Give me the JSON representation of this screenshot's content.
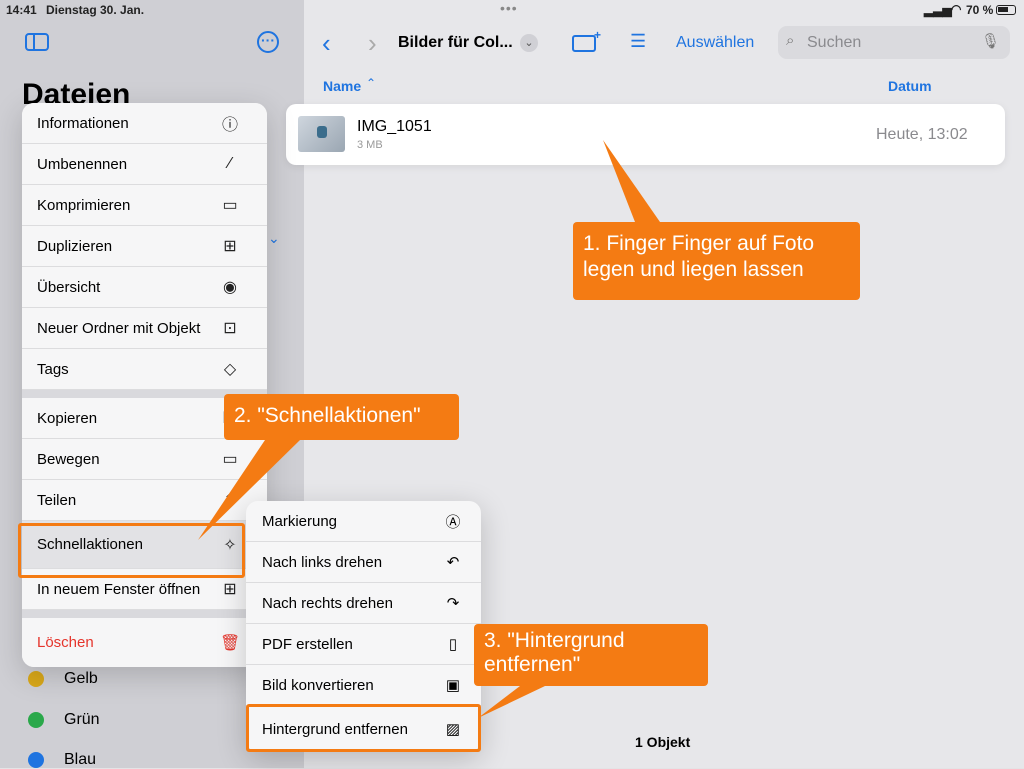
{
  "status": {
    "time": "14:41",
    "date": "Dienstag 30. Jan.",
    "battery": "70 %"
  },
  "sidebar": {
    "title": "Dateien",
    "tags": [
      {
        "label": "Gelb",
        "color": "#d9a81a"
      },
      {
        "label": "Grün",
        "color": "#2aa84a"
      },
      {
        "label": "Blau",
        "color": "#1f74e0"
      }
    ]
  },
  "toolbar": {
    "folder_title": "Bilder für Col...",
    "select_label": "Auswählen",
    "search_placeholder": "Suchen"
  },
  "columns": {
    "name": "Name",
    "date": "Datum"
  },
  "file": {
    "name": "IMG_1051",
    "size": "3 MB",
    "date": "Heute, 13:02"
  },
  "footer": {
    "count": "1 Objekt"
  },
  "context_menu": {
    "items": [
      "Informationen",
      "Umbenennen",
      "Komprimieren",
      "Duplizieren",
      "Übersicht",
      "Neuer Ordner mit Objekt",
      "Tags",
      "Kopieren",
      "Bewegen",
      "Teilen",
      "Schnellaktionen",
      "In neuem Fenster öffnen",
      "Löschen"
    ]
  },
  "submenu": {
    "items": [
      "Markierung",
      "Nach links drehen",
      "Nach rechts drehen",
      "PDF erstellen",
      "Bild konvertieren",
      "Hintergrund entfernen"
    ]
  },
  "callouts": {
    "step1": "1. Finger Finger auf Foto legen und liegen lassen",
    "step2": "2. \"Schnellaktionen\"",
    "step3": "3. \"Hintergrund entfernen\""
  },
  "accent_color": "#1f74e0",
  "callout_color": "#f47b13"
}
